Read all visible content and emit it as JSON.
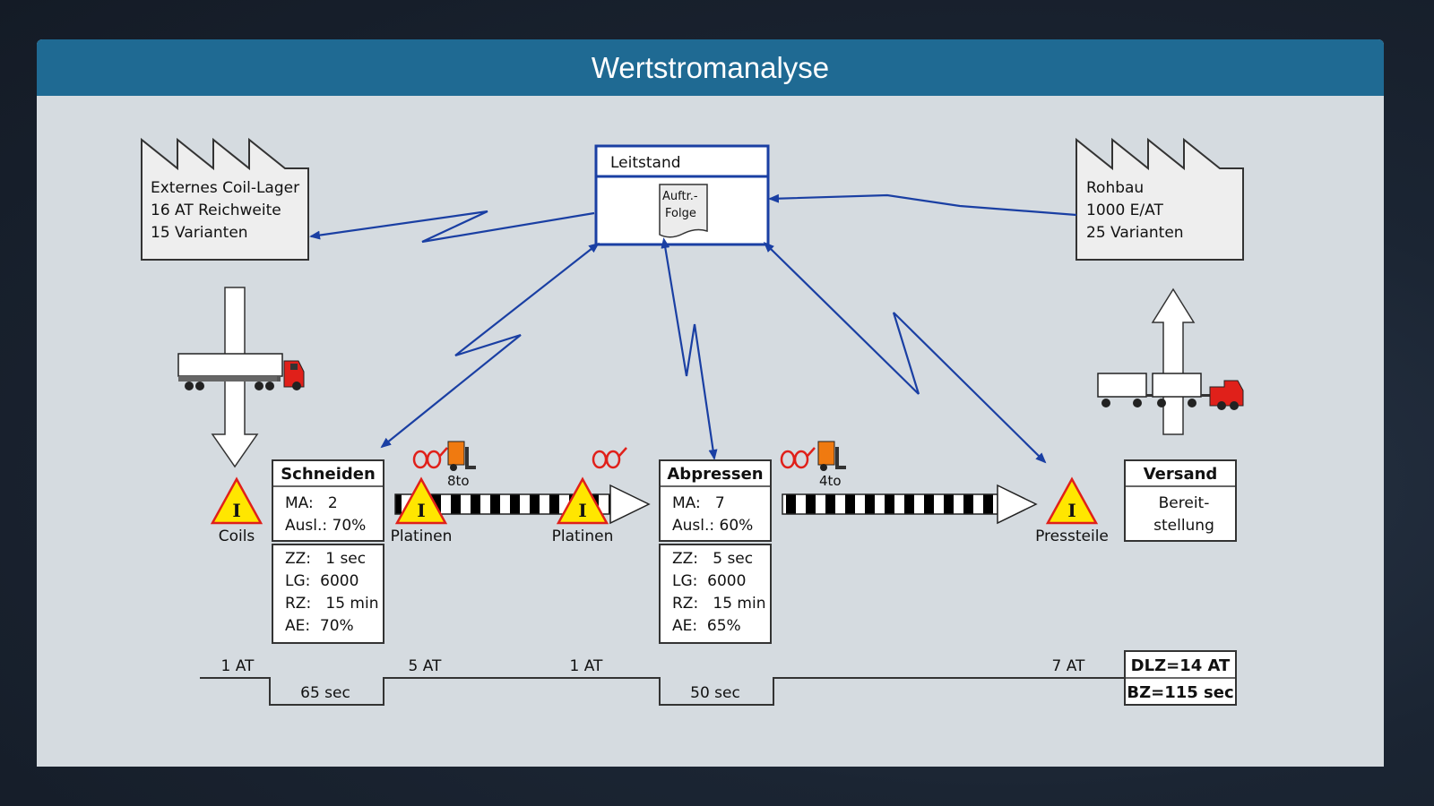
{
  "slide": {
    "title": "Wertstromanalyse"
  },
  "supplier": {
    "lines": [
      "Externes Coil-Lager",
      "16 AT Reichweite",
      "15 Varianten"
    ]
  },
  "customer": {
    "lines": [
      "Rohbau",
      "1000 E/AT",
      "25 Varianten"
    ]
  },
  "control": {
    "title": "Leitstand",
    "doc_lines": [
      "Auftr.-",
      "Folge"
    ]
  },
  "processes": [
    {
      "name": "Schneiden",
      "top": [
        "MA:   2",
        "Ausl.: 70%"
      ],
      "bottom": [
        "ZZ:   1 sec",
        "LG:  6000",
        "RZ:   15 min",
        "AE:  70%"
      ]
    },
    {
      "name": "Abpressen",
      "top": [
        "MA:   7",
        "Ausl.: 60%"
      ],
      "bottom": [
        "ZZ:   5 sec",
        "LG:  6000",
        "RZ:   15 min",
        "AE:  65%"
      ]
    }
  ],
  "shipping": {
    "name": "Versand",
    "lines": [
      "Bereit-",
      "stellung"
    ]
  },
  "inventory": [
    "Coils",
    "Platinen",
    "Platinen",
    "Pressteile"
  ],
  "inventory_symbol": "I",
  "forklift_loads": [
    "8to",
    "4to"
  ],
  "timeline": {
    "wait_times": [
      "1 AT",
      "5 AT",
      "1 AT",
      "7 AT"
    ],
    "process_times": [
      "65 sec",
      "50 sec"
    ],
    "total_lead": "DLZ=14 AT",
    "total_process": "BZ=115 sec"
  },
  "colors": {
    "title_bar": "#1f6a93",
    "info_arrow": "#1a3fa3",
    "warning_fill": "#ffe600",
    "warning_border": "#e0201a",
    "truck_cab": "#e0201a",
    "forklift": "#f07a10",
    "glasses": "#e0201a"
  },
  "icons": [
    "factory-icon",
    "truck-icon",
    "warning-triangle-icon",
    "forklift-icon",
    "glasses-icon",
    "document-icon",
    "push-arrow-icon"
  ]
}
